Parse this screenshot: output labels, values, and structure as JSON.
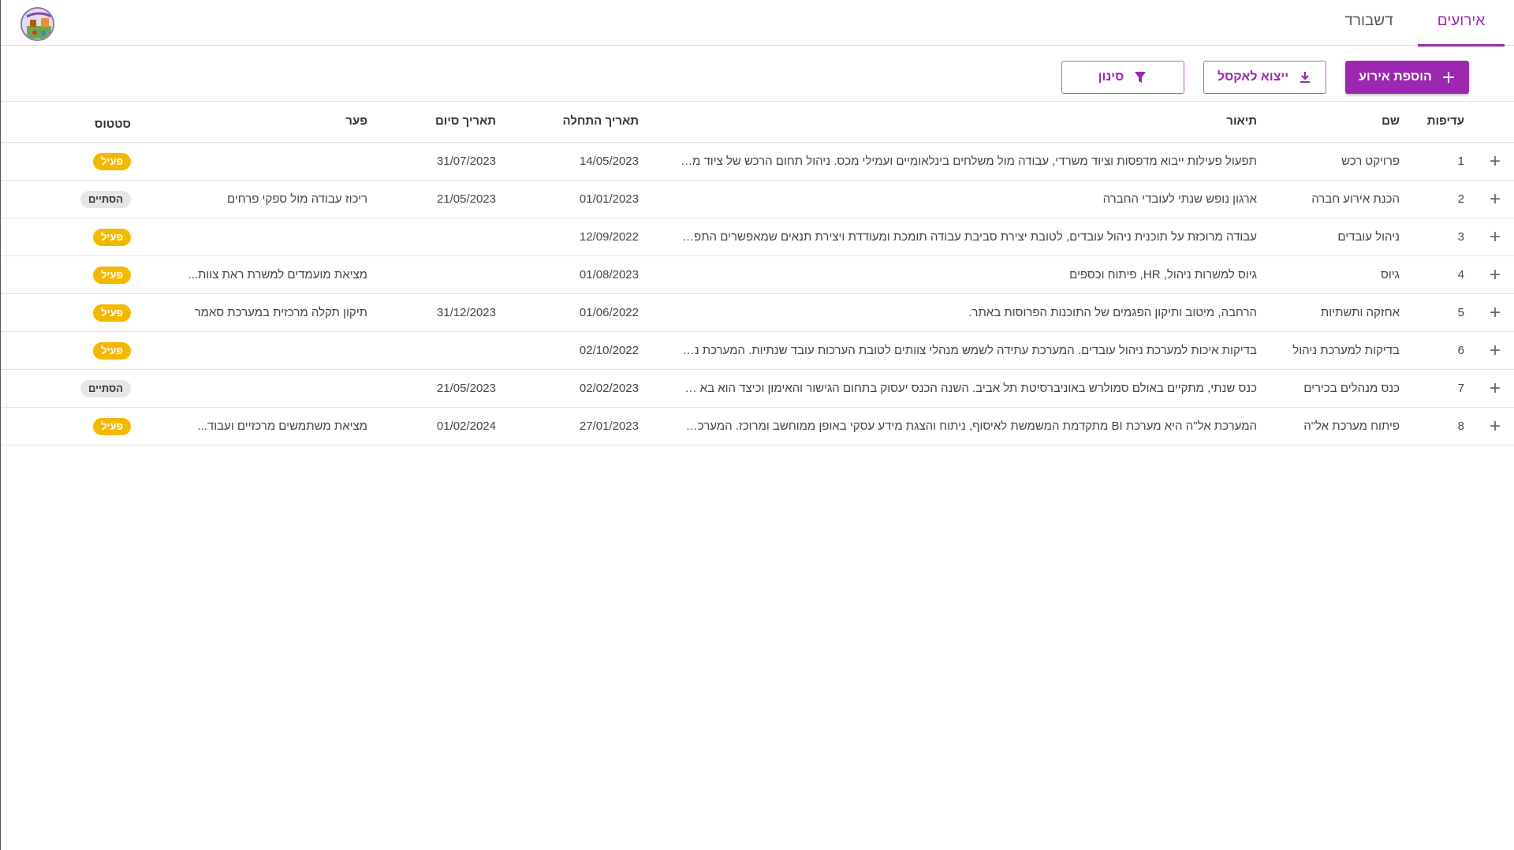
{
  "colors": {
    "accent": "#9c27b0",
    "active_badge": "#f5b800",
    "done_badge": "#e6e6e6"
  },
  "nav": {
    "tabs": [
      {
        "label": "אירועים",
        "selected": true
      },
      {
        "label": "דשבורד",
        "selected": false
      }
    ],
    "logo_icon": "events-logo-icon"
  },
  "toolbar": {
    "add_label": "הוספת אירוע",
    "add_icon": "plus-icon",
    "export_label": "ייצוא לאקסל",
    "export_icon": "download-icon",
    "filter_label": "סינון",
    "filter_icon": "filter-icon"
  },
  "table": {
    "headers": {
      "priority": "עדיפות",
      "name": "שם",
      "description": "תיאור",
      "start_date": "תאריך התחלה",
      "end_date": "תאריך סיום",
      "gap": "פער",
      "status": "סטטוס"
    },
    "rows": [
      {
        "expand": "+",
        "priority": "1",
        "name": "פרויקט רכש",
        "description": "תפעול פעילות ייבוא מדפסות וציוד משרדי, עבודה מול משלחים בינלאומיים ועמילי מכס. ניהול תחום הרכש של ציוד מש...",
        "start_date": "14/05/2023",
        "end_date": "31/07/2023",
        "gap": "",
        "status": "פעיל",
        "status_type": "active"
      },
      {
        "expand": "+",
        "priority": "2",
        "name": "הכנת אירוע חברה",
        "description": "ארגון נופש שנתי לעובדי החברה",
        "start_date": "01/01/2023",
        "end_date": "21/05/2023",
        "gap": "ריכוז עבודה מול ספקי פרחים",
        "status": "הסתיים",
        "status_type": "done"
      },
      {
        "expand": "+",
        "priority": "3",
        "name": "ניהול עובדים",
        "description": "עבודה מרוכזת על תוכנית ניהול עובדים, לטובת יצירת סביבת עבודה תומכת ומעודדת ויצירת תנאים שמאפשרים התפתחו...",
        "start_date": "12/09/2022",
        "end_date": "",
        "gap": "",
        "status": "פעיל",
        "status_type": "active"
      },
      {
        "expand": "+",
        "priority": "4",
        "name": "גיוס",
        "description": "גיוס למשרות ניהול, HR, פיתוח וכספים",
        "start_date": "01/08/2023",
        "end_date": "",
        "gap": "מציאת מועמדים למשרת ראת צוות...",
        "status": "פעיל",
        "status_type": "active"
      },
      {
        "expand": "+",
        "priority": "5",
        "name": "אחזקה ותשתיות",
        "description": "הרחבה, מיטוב ותיקון הפגמים של התוכנות הפרוסות באתר.",
        "start_date": "01/06/2022",
        "end_date": "31/12/2023",
        "gap": "תיקון תקלה מרכזית במערכת סאמר",
        "status": "פעיל",
        "status_type": "active"
      },
      {
        "expand": "+",
        "priority": "6",
        "name": "בדיקות למערכת ניהול",
        "description": "בדיקות איכות למערכת ניהול עובדים. המערכת עתידה לשמש מנהלי צוותים לטובת הערכות עובד שנתיות. המערכת נמצא...",
        "start_date": "02/10/2022",
        "end_date": "",
        "gap": "",
        "status": "פעיל",
        "status_type": "active"
      },
      {
        "expand": "+",
        "priority": "7",
        "name": "כנס מנהלים בכירים",
        "description": "כנס שנתי, מתקיים באולם סמולרש באוניברסיטת תל אביב. השנה הכנס יעסוק בתחום הגישור והאימון וכיצד הוא בא לידי...",
        "start_date": "02/02/2023",
        "end_date": "21/05/2023",
        "gap": "",
        "status": "הסתיים",
        "status_type": "done"
      },
      {
        "expand": "+",
        "priority": "8",
        "name": "פיתוח מערכת אל\"ה",
        "description": "המערכת אל\"ה היא מערכת BI מתקדמת המשמשת לאיסוף, ניתוח והצגת מידע עסקי באופן ממוחשב ומרוכז. המערכת מ...",
        "start_date": "27/01/2023",
        "end_date": "01/02/2024",
        "gap": "מציאת משתמשים מרכזיים ועבוד...",
        "status": "פעיל",
        "status_type": "active"
      }
    ]
  }
}
